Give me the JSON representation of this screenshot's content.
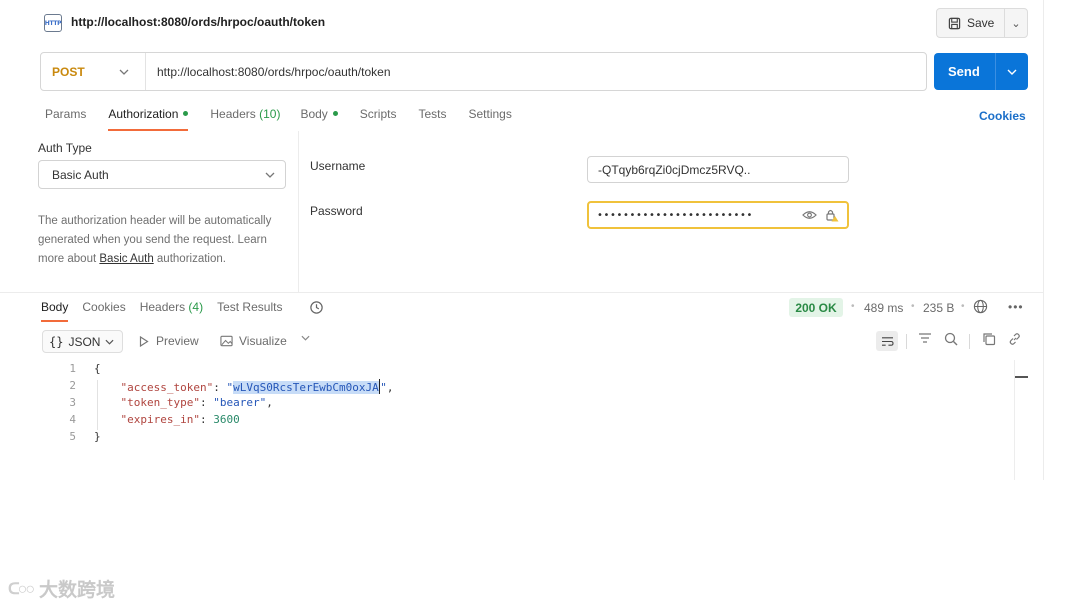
{
  "request": {
    "title": "http://localhost:8080/ords/hrpoc/oauth/token",
    "method": "POST",
    "url": "http://localhost:8080/ords/hrpoc/oauth/token",
    "save_label": "Save",
    "send_label": "Send",
    "http_icon_text": "HTTP"
  },
  "request_tabs": [
    {
      "label": "Params"
    },
    {
      "label": "Authorization"
    },
    {
      "label": "Headers",
      "count": "(10)"
    },
    {
      "label": "Body"
    },
    {
      "label": "Scripts"
    },
    {
      "label": "Tests"
    },
    {
      "label": "Settings"
    }
  ],
  "cookies_label": "Cookies",
  "auth": {
    "type_label": "Auth Type",
    "type_value": "Basic Auth",
    "description_pre": "The authorization header will be automatically generated when you send the request. Learn more about ",
    "description_link": "Basic Auth",
    "description_post": " authorization.",
    "username_label": "Username",
    "username_value": "-QTqyb6rqZi0cjDmcz5RVQ..",
    "password_label": "Password",
    "password_masked": "••••••••••••••••••••••••"
  },
  "response_tabs": [
    {
      "label": "Body"
    },
    {
      "label": "Cookies"
    },
    {
      "label": "Headers",
      "count": "(4)"
    },
    {
      "label": "Test Results"
    }
  ],
  "response_meta": {
    "status": "200 OK",
    "time": "489 ms",
    "size": "235 B"
  },
  "response_toolbar": {
    "format": "JSON",
    "preview_label": "Preview",
    "visualize_label": "Visualize"
  },
  "code": {
    "line_numbers": [
      "1",
      "2",
      "3",
      "4",
      "5"
    ],
    "open_brace": "{",
    "close_brace": "}",
    "access_token_key": "\"access_token\"",
    "access_token_value": "wLVqS0RcsTerEwbCm0oxJA",
    "token_type_key": "\"token_type\"",
    "token_type_value": "\"bearer\"",
    "expires_in_key": "\"expires_in\"",
    "expires_in_value": "3600"
  },
  "watermark_text": "大数跨境",
  "colors": {
    "send_blue": "#0a75d9",
    "post_orange": "#c9890e",
    "status_green": "#2a8a45",
    "tab_underline": "#f26b3a",
    "password_border": "#f0c23b"
  }
}
